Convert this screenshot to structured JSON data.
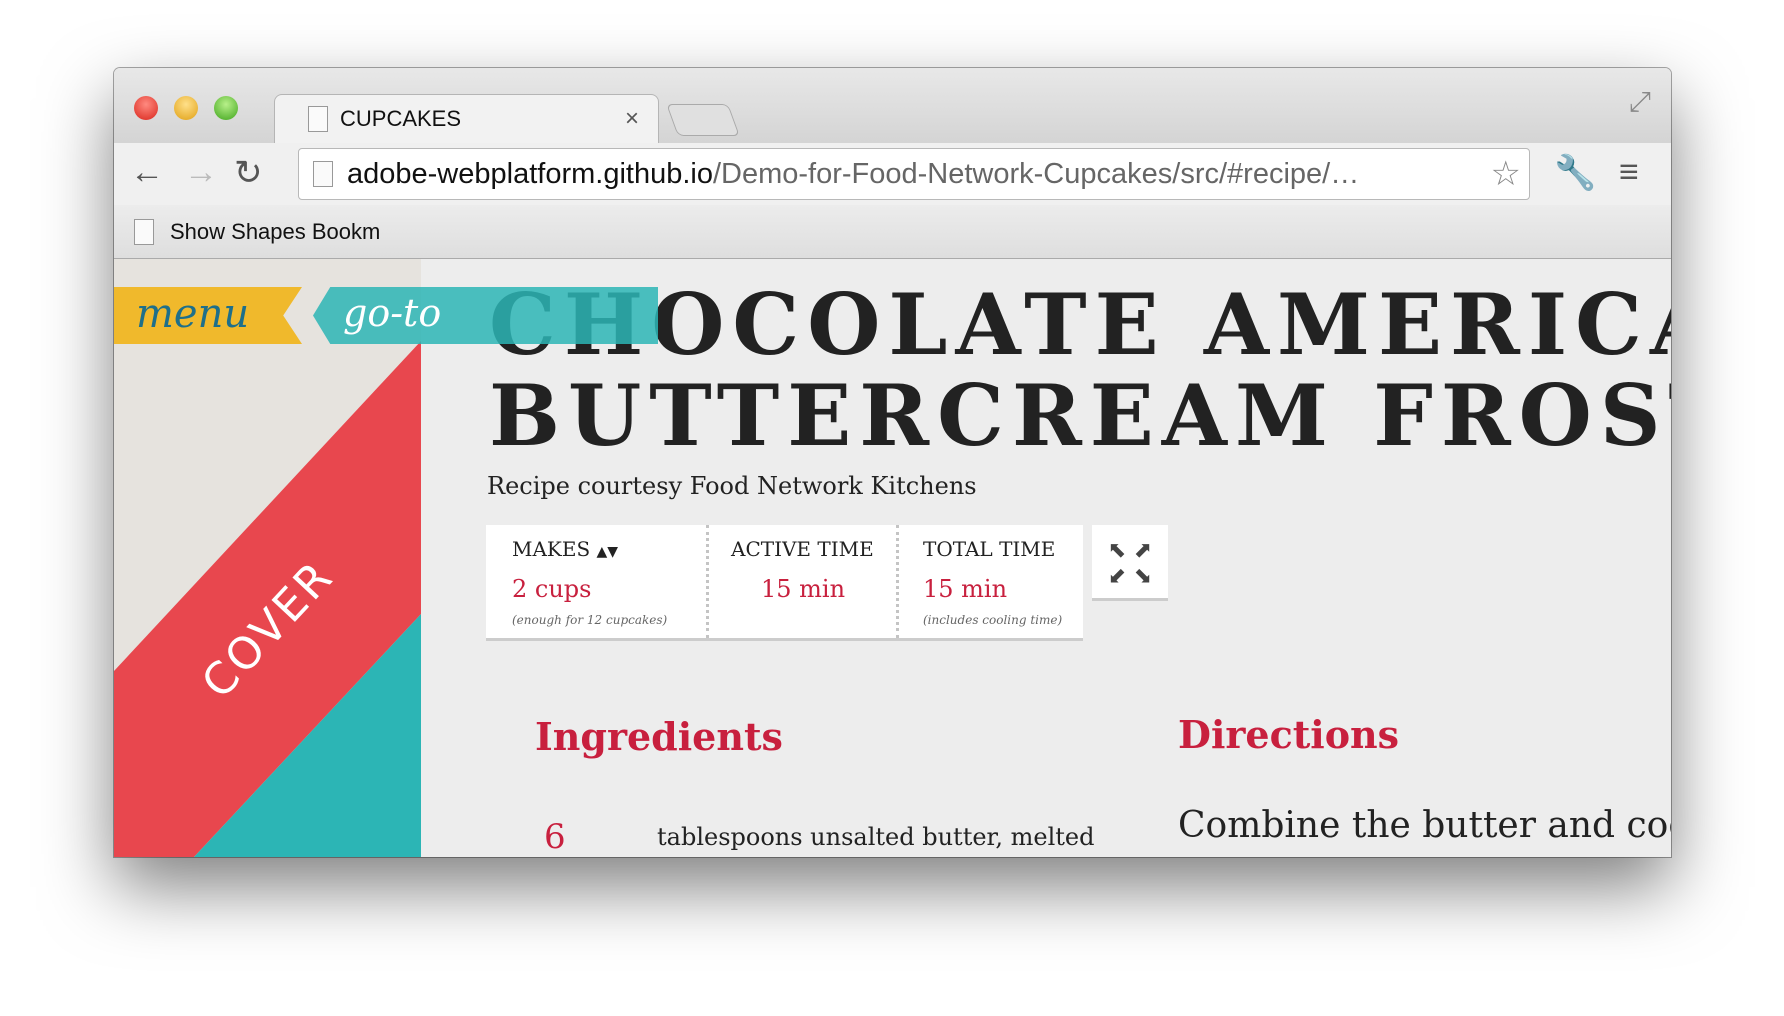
{
  "browser": {
    "tab_title": "CUPCAKES",
    "close": "×",
    "url_host": "adobe-webplatform.github.io",
    "url_path": "/Demo-for-Food-Network-Cupcakes/src/#recipe/…",
    "bookmark": "Show Shapes Bookm"
  },
  "nav": {
    "menu": "menu",
    "goto": "go-to",
    "cover": "COVER"
  },
  "recipe": {
    "title_line1": "CHOCOLATE AMERICA",
    "title_line2": "BUTTERCREAM FROST",
    "courtesy": "Recipe courtesy Food Network Kitchens",
    "makes": {
      "label": "MAKES",
      "sort_icon": "▲▼",
      "value": "2 cups",
      "note": "(enough for 12 cupcakes)"
    },
    "active": {
      "label": "ACTIVE TIME",
      "value": "15 min"
    },
    "total": {
      "label": "TOTAL TIME",
      "value": "15 min",
      "note": "(includes cooling time)"
    },
    "ingredients_heading": "Ingredients",
    "directions_heading": "Directions",
    "ingredients": [
      {
        "qty": "6",
        "text": "tablespoons unsalted butter, melted"
      }
    ],
    "direction_text": "Combine the butter and coc"
  },
  "colors": {
    "accent": "#c8203e",
    "yellow": "#f0b92c",
    "teal": "#2cb5b5",
    "red": "#e8474e"
  }
}
